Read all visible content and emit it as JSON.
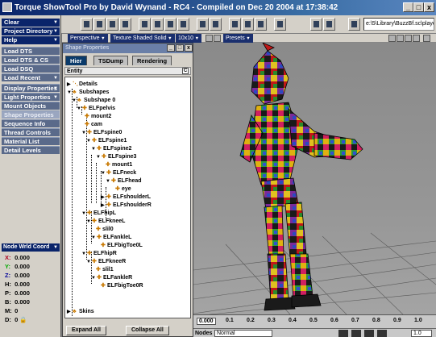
{
  "window": {
    "title": "Torque ShowTool Pro by David Wynand - RC4 - Compiled on Dec 20 2004 at 17:38:42",
    "min_label": "_",
    "max_label": "□",
    "close_label": "x"
  },
  "toolbar": {
    "path": "e:\\5\\Library\\BuzzBf.sc\\player.dts"
  },
  "left_menu": {
    "dropdowns": [
      "Clear",
      "Project Directory",
      "Help"
    ],
    "load_items": [
      "Load DTS",
      "Load DTS & CS",
      "Load DSQ",
      "Load Recent"
    ],
    "properties": [
      {
        "label": "Display Properties",
        "active": false
      },
      {
        "label": "Light Properties",
        "active": false
      },
      {
        "label": "Mount Objects",
        "active": false
      },
      {
        "label": "Shape Properties",
        "active": true
      },
      {
        "label": "Sequence Info",
        "active": false
      },
      {
        "label": "Thread Controls",
        "active": false
      },
      {
        "label": "Material List",
        "active": false
      },
      {
        "label": "Detail Levels",
        "active": false
      }
    ],
    "node_world_coord": "Node Wrld Coord",
    "coords": [
      {
        "axis": "X:",
        "value": "0.000"
      },
      {
        "axis": "Y:",
        "value": "0.000"
      },
      {
        "axis": "Z:",
        "value": "0.000"
      },
      {
        "axis": "H:",
        "value": "0.000"
      },
      {
        "axis": "P:",
        "value": "0.000"
      },
      {
        "axis": "B:",
        "value": "0.000"
      },
      {
        "axis": "M:",
        "value": "0"
      },
      {
        "axis": "D:",
        "value": "0"
      }
    ]
  },
  "view_bar": {
    "camera": "Perspective",
    "shading": "Texture Shaded Solid",
    "grid": "10x10",
    "presets": "Presets"
  },
  "panel": {
    "header": "Shape Properties",
    "tabs": [
      "Hier",
      "TSDump",
      "Rendering"
    ],
    "entity_label": "Entity",
    "entity_close": "C",
    "tree": [
      {
        "label": "Details"
      },
      {
        "label": "Subshapes"
      },
      {
        "label": "Subshape 0"
      },
      {
        "label": "ELFpelvis"
      },
      {
        "label": "mount2"
      },
      {
        "label": "cam"
      },
      {
        "label": "ELFspine0"
      },
      {
        "label": "ELFspine1"
      },
      {
        "label": "ELFspine2"
      },
      {
        "label": "ELFspine3"
      },
      {
        "label": "mount1"
      },
      {
        "label": "ELFneck"
      },
      {
        "label": "ELFhead"
      },
      {
        "label": "eye"
      },
      {
        "label": "ELFshoulderL"
      },
      {
        "label": "ELFshoulderR"
      },
      {
        "label": "ELFhipL"
      },
      {
        "label": "ELFkneeL"
      },
      {
        "label": "slil0"
      },
      {
        "label": "ELFankleL"
      },
      {
        "label": "ELFbigToe0L"
      },
      {
        "label": "ELFhipR"
      },
      {
        "label": "ELFkneeR"
      },
      {
        "label": "slil1"
      },
      {
        "label": "ELFankleR"
      },
      {
        "label": "ELFbigToe0R"
      },
      {
        "label": "Skins"
      }
    ],
    "expand_all": "Expand All",
    "collapse_all": "Collapse All"
  },
  "timeline": {
    "ticks": [
      "0.000",
      "0.1",
      "0.2",
      "0.3",
      "0.4",
      "0.5",
      "0.6",
      "0.7",
      "0.8",
      "0.9",
      "1.0"
    ],
    "normal_label": "Normal",
    "speed_value": "1.0"
  },
  "colors": {
    "titlebar": "#0a246a",
    "menu_dark": "#0a246a",
    "menu_button": "#5a6a8a",
    "viewport_bg": "#8a8a8a"
  }
}
